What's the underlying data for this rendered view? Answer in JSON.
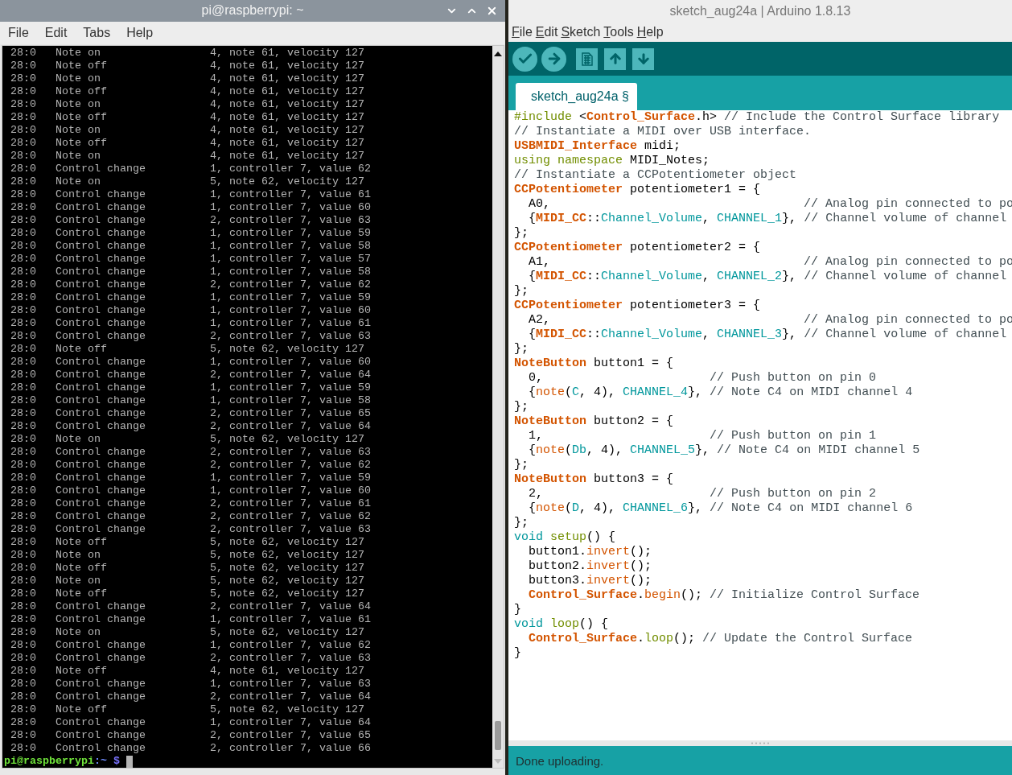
{
  "terminal": {
    "title": "pi@raspberrypi: ~",
    "menu": [
      "File",
      "Edit",
      "Tabs",
      "Help"
    ],
    "rows": [
      {
        "source": "28:0",
        "event": "Note on",
        "data": "4, note 61, velocity 127"
      },
      {
        "source": "28:0",
        "event": "Note off",
        "data": "4, note 61, velocity 127"
      },
      {
        "source": "28:0",
        "event": "Note on",
        "data": "4, note 61, velocity 127"
      },
      {
        "source": "28:0",
        "event": "Note off",
        "data": "4, note 61, velocity 127"
      },
      {
        "source": "28:0",
        "event": "Note on",
        "data": "4, note 61, velocity 127"
      },
      {
        "source": "28:0",
        "event": "Note off",
        "data": "4, note 61, velocity 127"
      },
      {
        "source": "28:0",
        "event": "Note on",
        "data": "4, note 61, velocity 127"
      },
      {
        "source": "28:0",
        "event": "Note off",
        "data": "4, note 61, velocity 127"
      },
      {
        "source": "28:0",
        "event": "Note on",
        "data": "4, note 61, velocity 127"
      },
      {
        "source": "28:0",
        "event": "Control change",
        "data": "1, controller 7, value 62"
      },
      {
        "source": "28:0",
        "event": "Note on",
        "data": "5, note 62, velocity 127"
      },
      {
        "source": "28:0",
        "event": "Control change",
        "data": "1, controller 7, value 61"
      },
      {
        "source": "28:0",
        "event": "Control change",
        "data": "1, controller 7, value 60"
      },
      {
        "source": "28:0",
        "event": "Control change",
        "data": "2, controller 7, value 63"
      },
      {
        "source": "28:0",
        "event": "Control change",
        "data": "1, controller 7, value 59"
      },
      {
        "source": "28:0",
        "event": "Control change",
        "data": "1, controller 7, value 58"
      },
      {
        "source": "28:0",
        "event": "Control change",
        "data": "1, controller 7, value 57"
      },
      {
        "source": "28:0",
        "event": "Control change",
        "data": "1, controller 7, value 58"
      },
      {
        "source": "28:0",
        "event": "Control change",
        "data": "2, controller 7, value 62"
      },
      {
        "source": "28:0",
        "event": "Control change",
        "data": "1, controller 7, value 59"
      },
      {
        "source": "28:0",
        "event": "Control change",
        "data": "1, controller 7, value 60"
      },
      {
        "source": "28:0",
        "event": "Control change",
        "data": "1, controller 7, value 61"
      },
      {
        "source": "28:0",
        "event": "Control change",
        "data": "2, controller 7, value 63"
      },
      {
        "source": "28:0",
        "event": "Note off",
        "data": "5, note 62, velocity 127"
      },
      {
        "source": "28:0",
        "event": "Control change",
        "data": "1, controller 7, value 60"
      },
      {
        "source": "28:0",
        "event": "Control change",
        "data": "2, controller 7, value 64"
      },
      {
        "source": "28:0",
        "event": "Control change",
        "data": "1, controller 7, value 59"
      },
      {
        "source": "28:0",
        "event": "Control change",
        "data": "1, controller 7, value 58"
      },
      {
        "source": "28:0",
        "event": "Control change",
        "data": "2, controller 7, value 65"
      },
      {
        "source": "28:0",
        "event": "Control change",
        "data": "2, controller 7, value 64"
      },
      {
        "source": "28:0",
        "event": "Note on",
        "data": "5, note 62, velocity 127"
      },
      {
        "source": "28:0",
        "event": "Control change",
        "data": "2, controller 7, value 63"
      },
      {
        "source": "28:0",
        "event": "Control change",
        "data": "2, controller 7, value 62"
      },
      {
        "source": "28:0",
        "event": "Control change",
        "data": "1, controller 7, value 59"
      },
      {
        "source": "28:0",
        "event": "Control change",
        "data": "1, controller 7, value 60"
      },
      {
        "source": "28:0",
        "event": "Control change",
        "data": "2, controller 7, value 61"
      },
      {
        "source": "28:0",
        "event": "Control change",
        "data": "2, controller 7, value 62"
      },
      {
        "source": "28:0",
        "event": "Control change",
        "data": "2, controller 7, value 63"
      },
      {
        "source": "28:0",
        "event": "Note off",
        "data": "5, note 62, velocity 127"
      },
      {
        "source": "28:0",
        "event": "Note on",
        "data": "5, note 62, velocity 127"
      },
      {
        "source": "28:0",
        "event": "Note off",
        "data": "5, note 62, velocity 127"
      },
      {
        "source": "28:0",
        "event": "Note on",
        "data": "5, note 62, velocity 127"
      },
      {
        "source": "28:0",
        "event": "Note off",
        "data": "5, note 62, velocity 127"
      },
      {
        "source": "28:0",
        "event": "Control change",
        "data": "2, controller 7, value 64"
      },
      {
        "source": "28:0",
        "event": "Control change",
        "data": "1, controller 7, value 61"
      },
      {
        "source": "28:0",
        "event": "Note on",
        "data": "5, note 62, velocity 127"
      },
      {
        "source": "28:0",
        "event": "Control change",
        "data": "1, controller 7, value 62"
      },
      {
        "source": "28:0",
        "event": "Control change",
        "data": "2, controller 7, value 63"
      },
      {
        "source": "28:0",
        "event": "Note off",
        "data": "4, note 61, velocity 127"
      },
      {
        "source": "28:0",
        "event": "Control change",
        "data": "1, controller 7, value 63"
      },
      {
        "source": "28:0",
        "event": "Control change",
        "data": "2, controller 7, value 64"
      },
      {
        "source": "28:0",
        "event": "Note off",
        "data": "5, note 62, velocity 127"
      },
      {
        "source": "28:0",
        "event": "Control change",
        "data": "1, controller 7, value 64"
      },
      {
        "source": "28:0",
        "event": "Control change",
        "data": "2, controller 7, value 65"
      },
      {
        "source": "28:0",
        "event": "Control change",
        "data": "2, controller 7, value 66"
      }
    ],
    "prompt": {
      "user_host": "pi@raspberrypi",
      "path": ":~",
      "symbol": "$"
    }
  },
  "arduino": {
    "title": "sketch_aug24a | Arduino 1.8.13",
    "menu": [
      "File",
      "Edit",
      "Sketch",
      "Tools",
      "Help"
    ],
    "tabs": [
      {
        "label": "sketch_aug24a §",
        "selected": true
      }
    ],
    "code": [
      [
        {
          "kind": "directive",
          "text": "#include"
        },
        {
          "kind": "plain",
          "text": " <"
        },
        {
          "kind": "class",
          "text": "Control_Surface"
        },
        {
          "kind": "plain",
          "text": ".h> "
        },
        {
          "kind": "comment",
          "text": "// Include the Control Surface library"
        }
      ],
      [
        {
          "kind": "comment",
          "text": "// Instantiate a MIDI over USB interface."
        }
      ],
      [
        {
          "kind": "class",
          "text": "USBMIDI_Interface"
        },
        {
          "kind": "plain",
          "text": " midi;"
        }
      ],
      [
        {
          "kind": "directive",
          "text": "using "
        },
        {
          "kind": "directive",
          "text": "namespace"
        },
        {
          "kind": "plain",
          "text": " MIDI_Notes;"
        }
      ],
      [
        {
          "kind": "comment",
          "text": "// Instantiate a CCPotentiometer object"
        }
      ],
      [
        {
          "kind": "class",
          "text": "CCPotentiometer"
        },
        {
          "kind": "plain",
          "text": " potentiometer1 = {"
        }
      ],
      [
        {
          "kind": "plain",
          "text": "  A0,                                   "
        },
        {
          "kind": "comment",
          "text": "// Analog pin connected to po"
        }
      ],
      [
        {
          "kind": "plain",
          "text": "  {"
        },
        {
          "kind": "class",
          "text": "MIDI_CC"
        },
        {
          "kind": "plain",
          "text": "::"
        },
        {
          "kind": "constant",
          "text": "Channel_Volume"
        },
        {
          "kind": "plain",
          "text": ", "
        },
        {
          "kind": "constant",
          "text": "CHANNEL_1"
        },
        {
          "kind": "plain",
          "text": "}, "
        },
        {
          "kind": "comment",
          "text": "// Channel volume of channel"
        }
      ],
      [
        {
          "kind": "plain",
          "text": "};"
        }
      ],
      [
        {
          "kind": "class",
          "text": "CCPotentiometer"
        },
        {
          "kind": "plain",
          "text": " potentiometer2 = {"
        }
      ],
      [
        {
          "kind": "plain",
          "text": "  A1,                                   "
        },
        {
          "kind": "comment",
          "text": "// Analog pin connected to po"
        }
      ],
      [
        {
          "kind": "plain",
          "text": "  {"
        },
        {
          "kind": "class",
          "text": "MIDI_CC"
        },
        {
          "kind": "plain",
          "text": "::"
        },
        {
          "kind": "constant",
          "text": "Channel_Volume"
        },
        {
          "kind": "plain",
          "text": ", "
        },
        {
          "kind": "constant",
          "text": "CHANNEL_2"
        },
        {
          "kind": "plain",
          "text": "}, "
        },
        {
          "kind": "comment",
          "text": "// Channel volume of channel"
        }
      ],
      [
        {
          "kind": "plain",
          "text": "};"
        }
      ],
      [
        {
          "kind": "class",
          "text": "CCPotentiometer"
        },
        {
          "kind": "plain",
          "text": " potentiometer3 = {"
        }
      ],
      [
        {
          "kind": "plain",
          "text": "  A2,                                   "
        },
        {
          "kind": "comment",
          "text": "// Analog pin connected to po"
        }
      ],
      [
        {
          "kind": "plain",
          "text": "  {"
        },
        {
          "kind": "class",
          "text": "MIDI_CC"
        },
        {
          "kind": "plain",
          "text": "::"
        },
        {
          "kind": "constant",
          "text": "Channel_Volume"
        },
        {
          "kind": "plain",
          "text": ", "
        },
        {
          "kind": "constant",
          "text": "CHANNEL_3"
        },
        {
          "kind": "plain",
          "text": "}, "
        },
        {
          "kind": "comment",
          "text": "// Channel volume of channel"
        }
      ],
      [
        {
          "kind": "plain",
          "text": "};"
        }
      ],
      [
        {
          "kind": "class",
          "text": "NoteButton"
        },
        {
          "kind": "plain",
          "text": " button1 = {"
        }
      ],
      [
        {
          "kind": "plain",
          "text": "  0,                       "
        },
        {
          "kind": "comment",
          "text": "// Push button on pin 0"
        }
      ],
      [
        {
          "kind": "plain",
          "text": "  {"
        },
        {
          "kind": "method",
          "text": "note"
        },
        {
          "kind": "plain",
          "text": "("
        },
        {
          "kind": "constant",
          "text": "C"
        },
        {
          "kind": "plain",
          "text": ", 4), "
        },
        {
          "kind": "constant",
          "text": "CHANNEL_4"
        },
        {
          "kind": "plain",
          "text": "}, "
        },
        {
          "kind": "comment",
          "text": "// Note C4 on MIDI channel 4"
        }
      ],
      [
        {
          "kind": "plain",
          "text": "};"
        }
      ],
      [
        {
          "kind": "class",
          "text": "NoteButton"
        },
        {
          "kind": "plain",
          "text": " button2 = {"
        }
      ],
      [
        {
          "kind": "plain",
          "text": "  1,                       "
        },
        {
          "kind": "comment",
          "text": "// Push button on pin 1"
        }
      ],
      [
        {
          "kind": "plain",
          "text": "  {"
        },
        {
          "kind": "method",
          "text": "note"
        },
        {
          "kind": "plain",
          "text": "("
        },
        {
          "kind": "constant",
          "text": "Db"
        },
        {
          "kind": "plain",
          "text": ", 4), "
        },
        {
          "kind": "constant",
          "text": "CHANNEL_5"
        },
        {
          "kind": "plain",
          "text": "}, "
        },
        {
          "kind": "comment",
          "text": "// Note C4 on MIDI channel 5"
        }
      ],
      [
        {
          "kind": "plain",
          "text": "};"
        }
      ],
      [
        {
          "kind": "class",
          "text": "NoteButton"
        },
        {
          "kind": "plain",
          "text": " button3 = {"
        }
      ],
      [
        {
          "kind": "plain",
          "text": "  2,                       "
        },
        {
          "kind": "comment",
          "text": "// Push button on pin 2"
        }
      ],
      [
        {
          "kind": "plain",
          "text": "  {"
        },
        {
          "kind": "method",
          "text": "note"
        },
        {
          "kind": "plain",
          "text": "("
        },
        {
          "kind": "constant",
          "text": "D"
        },
        {
          "kind": "plain",
          "text": ", 4), "
        },
        {
          "kind": "constant",
          "text": "CHANNEL_6"
        },
        {
          "kind": "plain",
          "text": "}, "
        },
        {
          "kind": "comment",
          "text": "// Note C4 on MIDI channel 6"
        }
      ],
      [
        {
          "kind": "plain",
          "text": "};"
        }
      ],
      [
        {
          "kind": "constant",
          "text": "void "
        },
        {
          "kind": "directive",
          "text": "setup"
        },
        {
          "kind": "plain",
          "text": "() {"
        }
      ],
      [
        {
          "kind": "plain",
          "text": "  button1."
        },
        {
          "kind": "method",
          "text": "invert"
        },
        {
          "kind": "plain",
          "text": "();"
        }
      ],
      [
        {
          "kind": "plain",
          "text": "  button2."
        },
        {
          "kind": "method",
          "text": "invert"
        },
        {
          "kind": "plain",
          "text": "();"
        }
      ],
      [
        {
          "kind": "plain",
          "text": "  button3."
        },
        {
          "kind": "method",
          "text": "invert"
        },
        {
          "kind": "plain",
          "text": "();"
        }
      ],
      [
        {
          "kind": "class",
          "text": "  Control_Surface"
        },
        {
          "kind": "plain",
          "text": "."
        },
        {
          "kind": "method",
          "text": "begin"
        },
        {
          "kind": "plain",
          "text": "(); "
        },
        {
          "kind": "comment",
          "text": "// Initialize Control Surface"
        }
      ],
      [
        {
          "kind": "plain",
          "text": "}"
        }
      ],
      [
        {
          "kind": "constant",
          "text": "void "
        },
        {
          "kind": "directive",
          "text": "loop"
        },
        {
          "kind": "plain",
          "text": "() {"
        }
      ],
      [
        {
          "kind": "class",
          "text": "  Control_Surface"
        },
        {
          "kind": "plain",
          "text": "."
        },
        {
          "kind": "directive",
          "text": "loop"
        },
        {
          "kind": "plain",
          "text": "(); "
        },
        {
          "kind": "comment",
          "text": "// Update the Control Surface"
        }
      ],
      [
        {
          "kind": "plain",
          "text": "}"
        }
      ]
    ],
    "status": "Done uploading."
  }
}
